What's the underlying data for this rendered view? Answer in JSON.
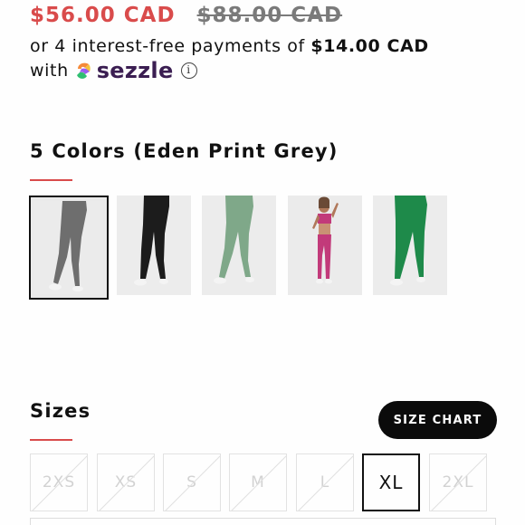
{
  "price": {
    "sale": "$56.00 CAD",
    "original": "$88.00 CAD",
    "sale_color": "#d94b4b"
  },
  "installments": {
    "prefix": "or 4 interest-free payments of",
    "amount": "$14.00 CAD",
    "with_text": "with",
    "provider": "sezzle",
    "info_glyph": "i"
  },
  "colors_section": {
    "title": "5 Colors (Eden Print Grey)",
    "swatches": [
      {
        "name": "Eden Print Grey",
        "selected": true,
        "color": "#6f6f6f"
      },
      {
        "name": "Black",
        "selected": false,
        "color": "#1c1c1c"
      },
      {
        "name": "Sage Green",
        "selected": false,
        "color": "#7fa889"
      },
      {
        "name": "Pink",
        "selected": false,
        "color": "#c23a7a"
      },
      {
        "name": "Green",
        "selected": false,
        "color": "#1e8a4a"
      }
    ]
  },
  "sizes_section": {
    "title": "Sizes",
    "size_chart_label": "SIZE CHART",
    "sizes": [
      {
        "label": "2XS",
        "available": false
      },
      {
        "label": "XS",
        "available": false
      },
      {
        "label": "S",
        "available": false
      },
      {
        "label": "M",
        "available": false
      },
      {
        "label": "L",
        "available": false
      },
      {
        "label": "XL",
        "available": true
      },
      {
        "label": "2XL",
        "available": false
      }
    ]
  }
}
